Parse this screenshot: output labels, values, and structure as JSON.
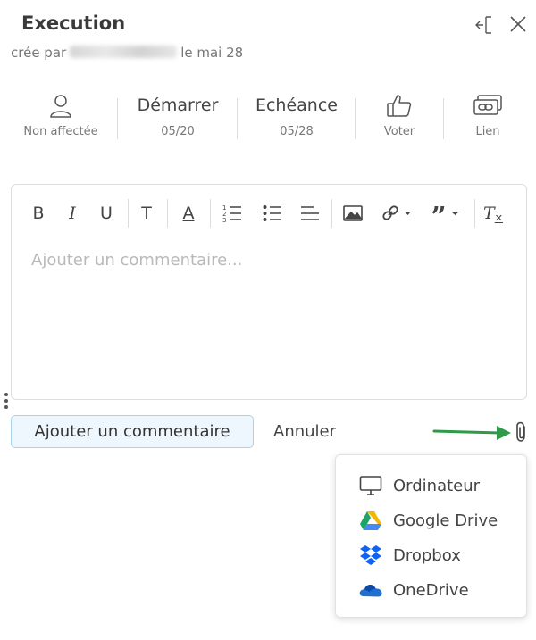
{
  "header": {
    "title": "Execution",
    "created_by_prefix": "crée par",
    "created_by_suffix": "le mai 28"
  },
  "meta": {
    "assignee": {
      "label": "Non affectée",
      "icon": "user-icon"
    },
    "start": {
      "label": "Démarrer",
      "value": "05/20"
    },
    "due": {
      "label": "Echéance",
      "value": "05/28"
    },
    "vote": {
      "label": "Voter",
      "icon": "thumbs-up-icon"
    },
    "link": {
      "label": "Lien",
      "icon": "link-card-icon"
    }
  },
  "toolbar": {
    "bold": "B",
    "italic": "I",
    "underline": "U",
    "text_size": "T",
    "font_color": "A",
    "quote": "”",
    "clear_format": "T"
  },
  "editor": {
    "placeholder": "Ajouter un commentaire..."
  },
  "actions": {
    "submit": "Ajouter un commentaire",
    "cancel": "Annuler"
  },
  "attach_menu": {
    "items": [
      {
        "label": "Ordinateur",
        "icon": "monitor-icon"
      },
      {
        "label": "Google Drive",
        "icon": "google-drive-icon"
      },
      {
        "label": "Dropbox",
        "icon": "dropbox-icon"
      },
      {
        "label": "OneDrive",
        "icon": "onedrive-icon"
      }
    ]
  },
  "colors": {
    "arrow": "#2e9a4a",
    "primary_border": "#a9d2ec",
    "primary_bg": "#eef7fd"
  }
}
